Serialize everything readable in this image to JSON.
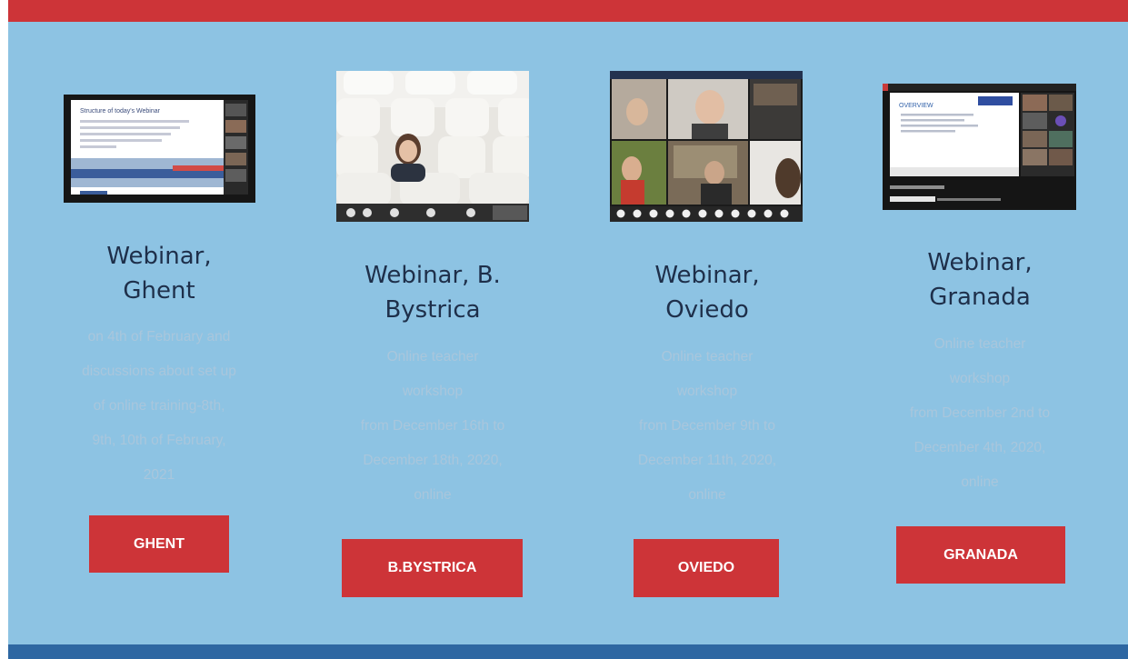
{
  "colors": {
    "background": "#8dc3e3",
    "accent_red": "#cd3438",
    "footer_blue": "#2e67a2",
    "title_text": "#1e2f4a",
    "desc_text": "#a9c6dc"
  },
  "cards": [
    {
      "title": "Webinar, Ghent",
      "title_lines": [
        "Webinar,",
        "Ghent"
      ],
      "desc_lines": [
        "on 4th of February and",
        "discussions about set up",
        "of online training-8th,",
        "9th, 10th of February,",
        "2021"
      ],
      "button": "GHENT",
      "thumb": {
        "slide_title": "Structure of today's Webinar"
      }
    },
    {
      "title": "Webinar, B. Bystrica",
      "title_lines": [
        "Webinar, B.",
        "Bystrica"
      ],
      "desc_lines": [
        "Online teacher",
        "workshop",
        "from December 16th to",
        "December 18th, 2020,",
        "online"
      ],
      "button": "B.BYSTRICA"
    },
    {
      "title": "Webinar, Oviedo",
      "title_lines": [
        "Webinar,",
        "Oviedo"
      ],
      "desc_lines": [
        "Online teacher",
        "workshop",
        "from December 9th to",
        "December 11th, 2020,",
        "online"
      ],
      "button": "OVIEDO"
    },
    {
      "title": "Webinar, Granada",
      "title_lines": [
        "Webinar,",
        "Granada"
      ],
      "desc_lines": [
        "Online teacher",
        "workshop",
        "from December 2nd to",
        "December 4th, 2020,",
        "online"
      ],
      "button": "GRANADA",
      "thumb": {
        "slide_title": "OVERVIEW"
      }
    }
  ]
}
